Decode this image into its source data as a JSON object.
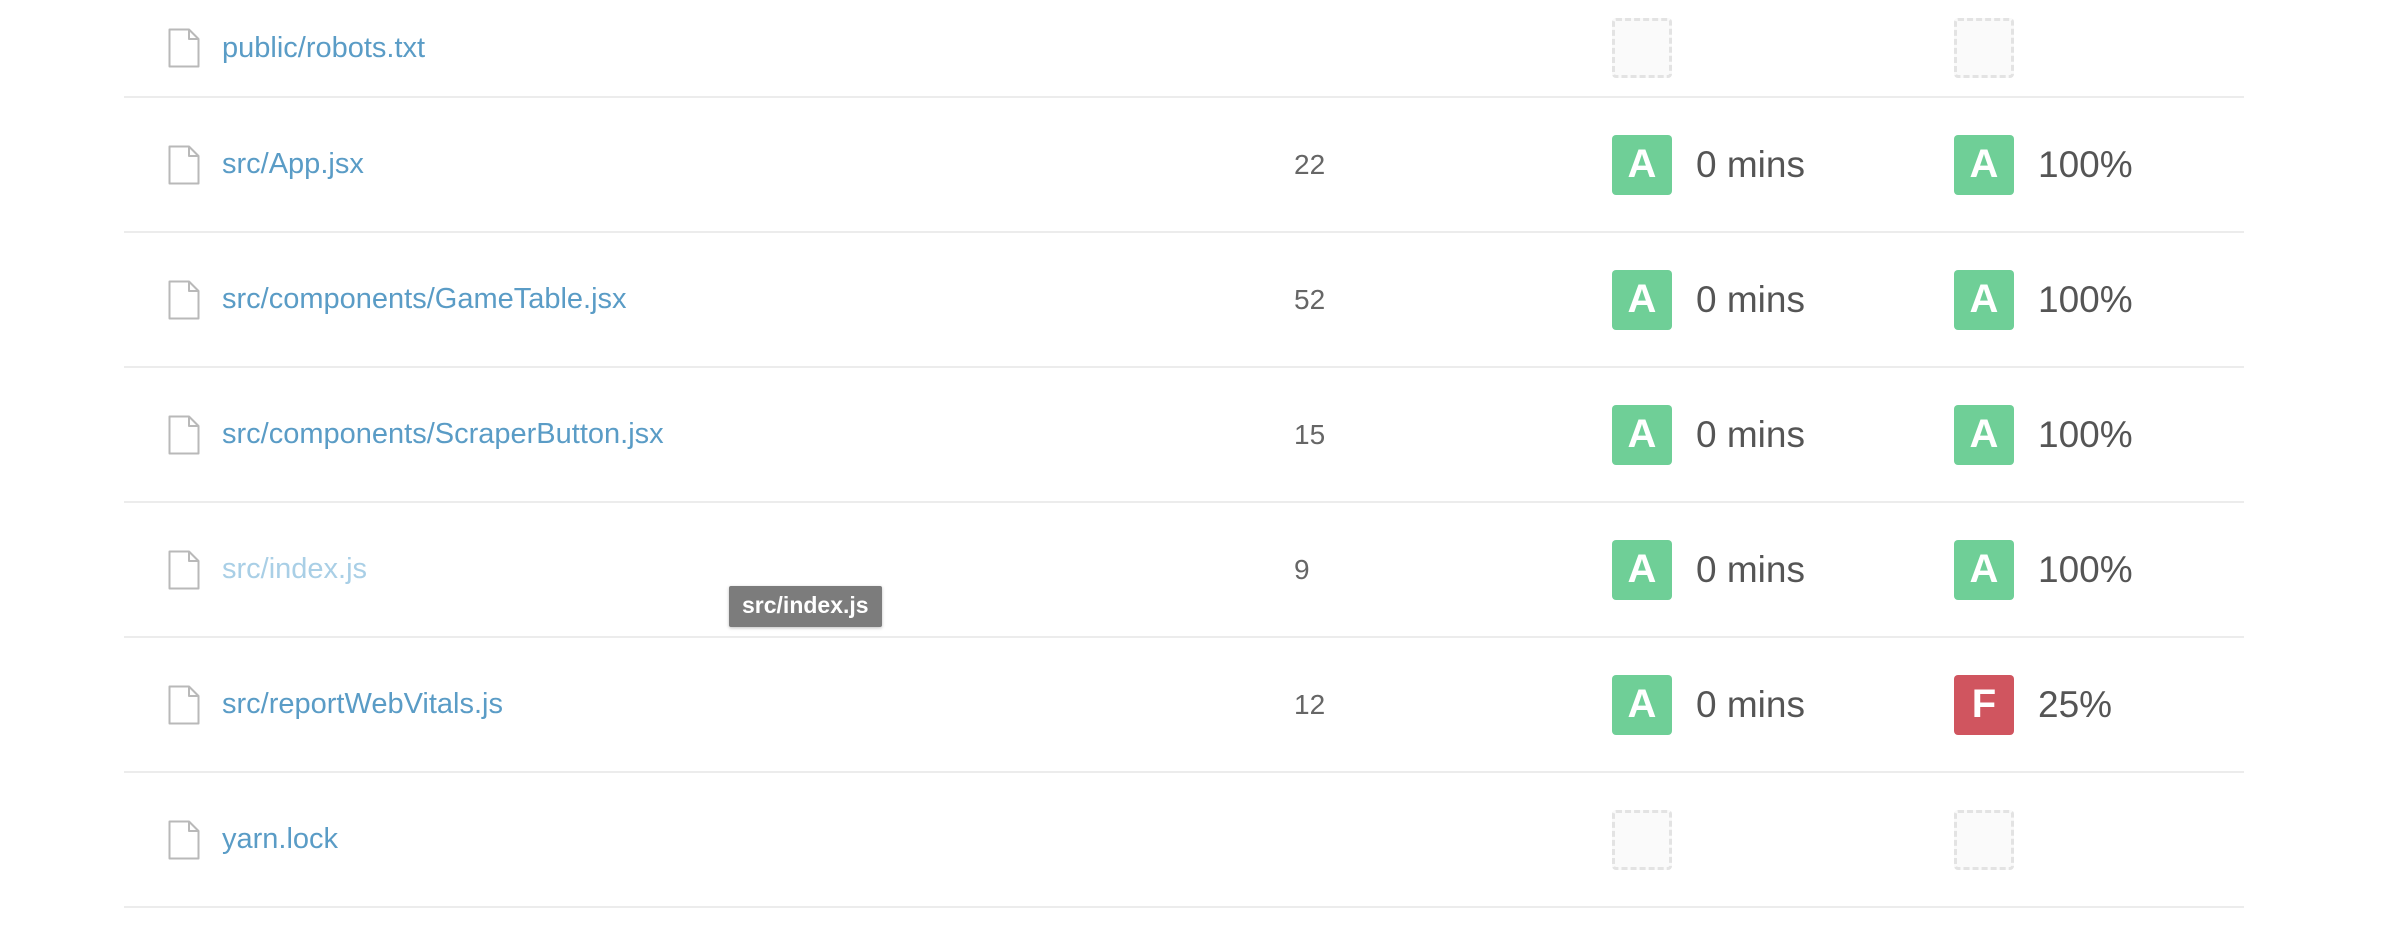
{
  "grade_colors": {
    "A": "#6fcf97",
    "F": "#d0555f"
  },
  "rows": [
    {
      "path": "public/robots.txt",
      "lines": "",
      "maintainability": {
        "grade": "",
        "value": ""
      },
      "coverage": {
        "grade": "",
        "value": ""
      }
    },
    {
      "path": "src/App.jsx",
      "lines": "22",
      "maintainability": {
        "grade": "A",
        "value": "0 mins"
      },
      "coverage": {
        "grade": "A",
        "value": "100%"
      }
    },
    {
      "path": "src/components/GameTable.jsx",
      "lines": "52",
      "maintainability": {
        "grade": "A",
        "value": "0 mins"
      },
      "coverage": {
        "grade": "A",
        "value": "100%"
      }
    },
    {
      "path": "src/components/ScraperButton.jsx",
      "lines": "15",
      "maintainability": {
        "grade": "A",
        "value": "0 mins"
      },
      "coverage": {
        "grade": "A",
        "value": "100%"
      }
    },
    {
      "path": "src/index.js",
      "lines": "9",
      "maintainability": {
        "grade": "A",
        "value": "0 mins"
      },
      "coverage": {
        "grade": "A",
        "value": "100%"
      }
    },
    {
      "path": "src/reportWebVitals.js",
      "lines": "12",
      "maintainability": {
        "grade": "A",
        "value": "0 mins"
      },
      "coverage": {
        "grade": "F",
        "value": "25%"
      }
    },
    {
      "path": "yarn.lock",
      "lines": "",
      "maintainability": {
        "grade": "",
        "value": ""
      },
      "coverage": {
        "grade": "",
        "value": ""
      }
    }
  ],
  "hovered_row": 4,
  "tooltip": {
    "text": "src/index.js"
  },
  "icons": {
    "file": "file-icon"
  }
}
